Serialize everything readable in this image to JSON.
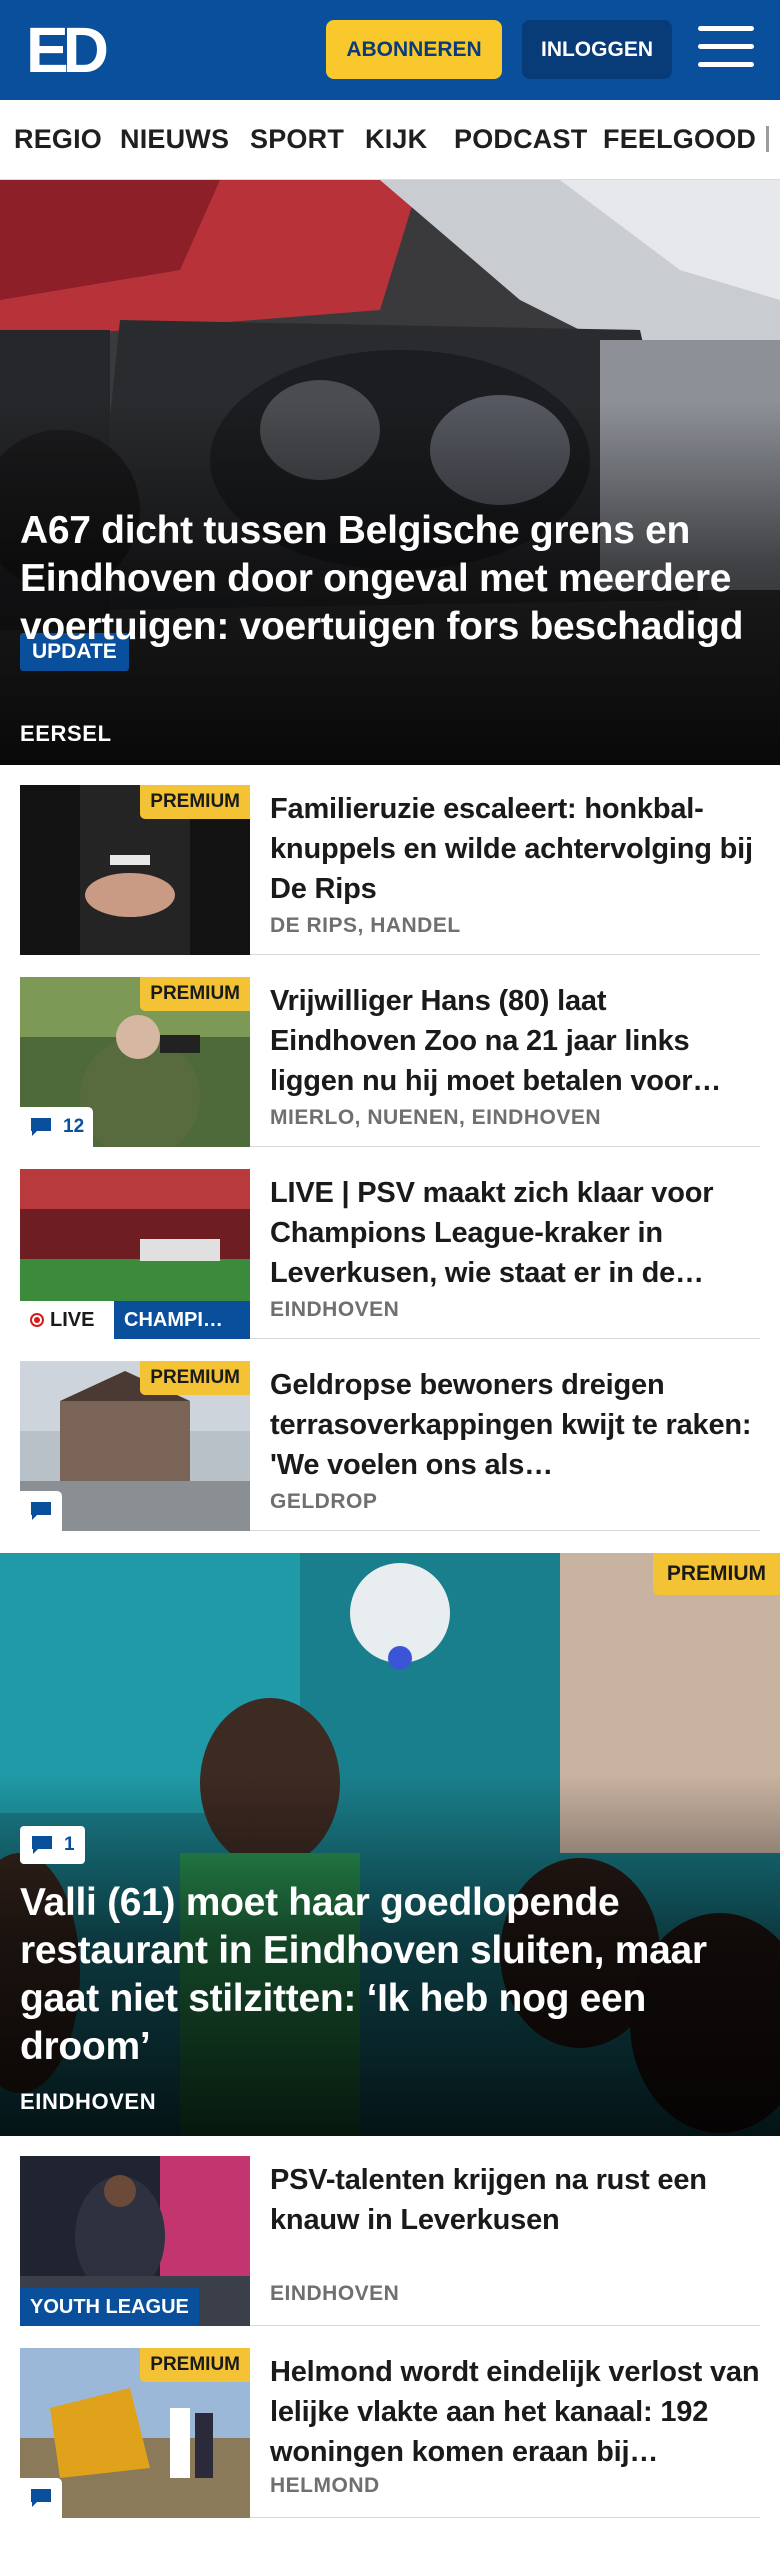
{
  "header": {
    "logo_text": "ED",
    "subscribe_label": "ABONNEREN",
    "login_label": "INLOGGEN",
    "brand_color": "#0a4f9c",
    "accent_color": "#f9c82c"
  },
  "nav": {
    "items": [
      "REGIO",
      "NIEUWS",
      "SPORT",
      "KIJK",
      "PODCAST",
      "FEELGOOD"
    ]
  },
  "hero_top": {
    "tag": "UPDATE",
    "title": "A67 dicht tussen Belgische grens en Eindhoven door ongeval met meerdere voertuigen: voertuigen fors beschadigd",
    "location": "EERSEL"
  },
  "list_top": [
    {
      "badge": "PREMIUM",
      "title": "Familieruzie escaleert: honkbal-knuppels en wilde achtervolging bij De Rips",
      "location": "DE RIPS, HANDEL"
    },
    {
      "badge": "PREMIUM",
      "comments": "12",
      "title": "Vrijwilliger Hans (80) laat Eindhoven Zoo na 21 jaar links liggen nu hij moet betalen voor…",
      "location": "MIERLO, NUENEN, EINDHOVEN"
    },
    {
      "live": "LIVE",
      "category": "CHAMPI…",
      "title": "LIVE | PSV maakt zich klaar voor Champions League-kraker in Leverkusen, wie staat er in de…",
      "location": "EINDHOVEN"
    },
    {
      "badge": "PREMIUM",
      "title": "Geldropse bewoners dreigen terrasoverkappingen kwijt te raken: 'We voelen ons als…",
      "location": "GELDROP"
    }
  ],
  "hero_bottom": {
    "badge": "PREMIUM",
    "comments": "1",
    "title": "Valli (61) moet haar goedlopende restaurant in Eindhoven sluiten, maar gaat niet stilzitten: ‘Ik heb nog een droom’",
    "location": "EINDHOVEN"
  },
  "list_bottom": [
    {
      "category": "YOUTH LEAGUE",
      "title": "PSV-talenten krijgen na rust een knauw in Leverkusen",
      "location": "EINDHOVEN"
    },
    {
      "badge": "PREMIUM",
      "title": "Helmond wordt eindelijk verlost van lelijke vlakte aan het kanaal: 192 woningen komen eraan bij…",
      "location": "HELMOND"
    }
  ],
  "icons": {
    "menu": "hamburger-menu-icon",
    "comment": "comment-bubble-icon",
    "live": "live-dot-icon"
  }
}
